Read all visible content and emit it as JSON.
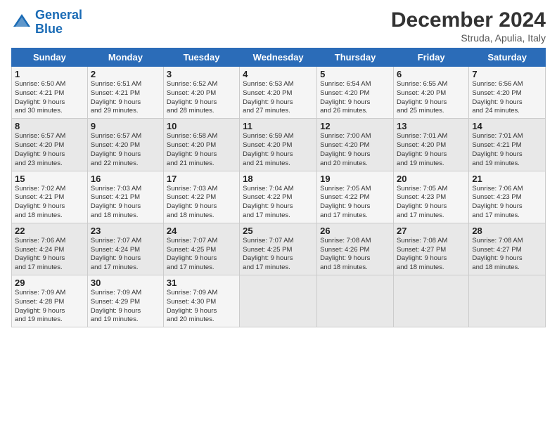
{
  "logo": {
    "line1": "General",
    "line2": "Blue"
  },
  "title": "December 2024",
  "subtitle": "Struda, Apulia, Italy",
  "header": {
    "days": [
      "Sunday",
      "Monday",
      "Tuesday",
      "Wednesday",
      "Thursday",
      "Friday",
      "Saturday"
    ]
  },
  "weeks": [
    [
      {
        "day": "1",
        "info": "Sunrise: 6:50 AM\nSunset: 4:21 PM\nDaylight: 9 hours\nand 30 minutes."
      },
      {
        "day": "2",
        "info": "Sunrise: 6:51 AM\nSunset: 4:21 PM\nDaylight: 9 hours\nand 29 minutes."
      },
      {
        "day": "3",
        "info": "Sunrise: 6:52 AM\nSunset: 4:20 PM\nDaylight: 9 hours\nand 28 minutes."
      },
      {
        "day": "4",
        "info": "Sunrise: 6:53 AM\nSunset: 4:20 PM\nDaylight: 9 hours\nand 27 minutes."
      },
      {
        "day": "5",
        "info": "Sunrise: 6:54 AM\nSunset: 4:20 PM\nDaylight: 9 hours\nand 26 minutes."
      },
      {
        "day": "6",
        "info": "Sunrise: 6:55 AM\nSunset: 4:20 PM\nDaylight: 9 hours\nand 25 minutes."
      },
      {
        "day": "7",
        "info": "Sunrise: 6:56 AM\nSunset: 4:20 PM\nDaylight: 9 hours\nand 24 minutes."
      }
    ],
    [
      {
        "day": "8",
        "info": "Sunrise: 6:57 AM\nSunset: 4:20 PM\nDaylight: 9 hours\nand 23 minutes."
      },
      {
        "day": "9",
        "info": "Sunrise: 6:57 AM\nSunset: 4:20 PM\nDaylight: 9 hours\nand 22 minutes."
      },
      {
        "day": "10",
        "info": "Sunrise: 6:58 AM\nSunset: 4:20 PM\nDaylight: 9 hours\nand 21 minutes."
      },
      {
        "day": "11",
        "info": "Sunrise: 6:59 AM\nSunset: 4:20 PM\nDaylight: 9 hours\nand 21 minutes."
      },
      {
        "day": "12",
        "info": "Sunrise: 7:00 AM\nSunset: 4:20 PM\nDaylight: 9 hours\nand 20 minutes."
      },
      {
        "day": "13",
        "info": "Sunrise: 7:01 AM\nSunset: 4:20 PM\nDaylight: 9 hours\nand 19 minutes."
      },
      {
        "day": "14",
        "info": "Sunrise: 7:01 AM\nSunset: 4:21 PM\nDaylight: 9 hours\nand 19 minutes."
      }
    ],
    [
      {
        "day": "15",
        "info": "Sunrise: 7:02 AM\nSunset: 4:21 PM\nDaylight: 9 hours\nand 18 minutes."
      },
      {
        "day": "16",
        "info": "Sunrise: 7:03 AM\nSunset: 4:21 PM\nDaylight: 9 hours\nand 18 minutes."
      },
      {
        "day": "17",
        "info": "Sunrise: 7:03 AM\nSunset: 4:22 PM\nDaylight: 9 hours\nand 18 minutes."
      },
      {
        "day": "18",
        "info": "Sunrise: 7:04 AM\nSunset: 4:22 PM\nDaylight: 9 hours\nand 17 minutes."
      },
      {
        "day": "19",
        "info": "Sunrise: 7:05 AM\nSunset: 4:22 PM\nDaylight: 9 hours\nand 17 minutes."
      },
      {
        "day": "20",
        "info": "Sunrise: 7:05 AM\nSunset: 4:23 PM\nDaylight: 9 hours\nand 17 minutes."
      },
      {
        "day": "21",
        "info": "Sunrise: 7:06 AM\nSunset: 4:23 PM\nDaylight: 9 hours\nand 17 minutes."
      }
    ],
    [
      {
        "day": "22",
        "info": "Sunrise: 7:06 AM\nSunset: 4:24 PM\nDaylight: 9 hours\nand 17 minutes."
      },
      {
        "day": "23",
        "info": "Sunrise: 7:07 AM\nSunset: 4:24 PM\nDaylight: 9 hours\nand 17 minutes."
      },
      {
        "day": "24",
        "info": "Sunrise: 7:07 AM\nSunset: 4:25 PM\nDaylight: 9 hours\nand 17 minutes."
      },
      {
        "day": "25",
        "info": "Sunrise: 7:07 AM\nSunset: 4:25 PM\nDaylight: 9 hours\nand 17 minutes."
      },
      {
        "day": "26",
        "info": "Sunrise: 7:08 AM\nSunset: 4:26 PM\nDaylight: 9 hours\nand 18 minutes."
      },
      {
        "day": "27",
        "info": "Sunrise: 7:08 AM\nSunset: 4:27 PM\nDaylight: 9 hours\nand 18 minutes."
      },
      {
        "day": "28",
        "info": "Sunrise: 7:08 AM\nSunset: 4:27 PM\nDaylight: 9 hours\nand 18 minutes."
      }
    ],
    [
      {
        "day": "29",
        "info": "Sunrise: 7:09 AM\nSunset: 4:28 PM\nDaylight: 9 hours\nand 19 minutes."
      },
      {
        "day": "30",
        "info": "Sunrise: 7:09 AM\nSunset: 4:29 PM\nDaylight: 9 hours\nand 19 minutes."
      },
      {
        "day": "31",
        "info": "Sunrise: 7:09 AM\nSunset: 4:30 PM\nDaylight: 9 hours\nand 20 minutes."
      },
      {
        "day": "",
        "info": ""
      },
      {
        "day": "",
        "info": ""
      },
      {
        "day": "",
        "info": ""
      },
      {
        "day": "",
        "info": ""
      }
    ]
  ]
}
